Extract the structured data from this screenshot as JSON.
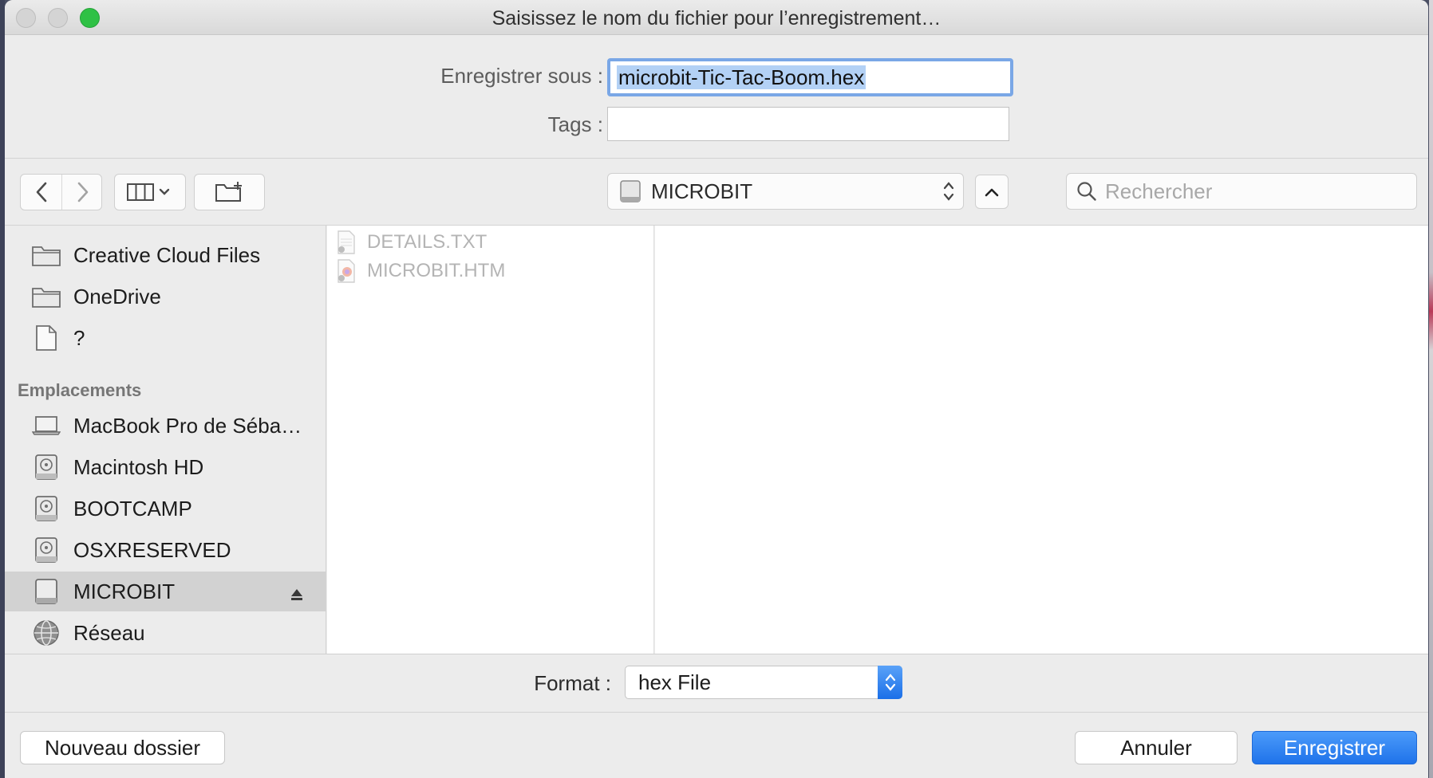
{
  "window": {
    "title": "Saisissez le nom du fichier pour l’enregistrement…"
  },
  "form": {
    "save_as_label": "Enregistrer sous :",
    "save_as_value": "microbit-Tic-Tac-Boom.hex",
    "tags_label": "Tags :",
    "tags_value": ""
  },
  "toolbar": {
    "location": "MICROBIT",
    "search_placeholder": "Rechercher"
  },
  "sidebar": {
    "favorites": [
      {
        "label": "Creative Cloud Files",
        "icon": "folder-icon"
      },
      {
        "label": "OneDrive",
        "icon": "folder-icon"
      },
      {
        "label": "?",
        "icon": "document-icon"
      }
    ],
    "locations_heading": "Emplacements",
    "locations": [
      {
        "label": "MacBook Pro de Séba…",
        "icon": "laptop-icon"
      },
      {
        "label": "Macintosh HD",
        "icon": "hard-drive-icon"
      },
      {
        "label": "BOOTCAMP",
        "icon": "hard-drive-icon"
      },
      {
        "label": "OSXRESERVED",
        "icon": "hard-drive-icon"
      },
      {
        "label": "MICROBIT",
        "icon": "external-drive-icon",
        "selected": true
      },
      {
        "label": "Réseau",
        "icon": "network-globe-icon"
      }
    ]
  },
  "files": [
    {
      "name": "DETAILS.TXT",
      "icon": "text-file-icon"
    },
    {
      "name": "MICROBIT.HTM",
      "icon": "html-file-icon"
    }
  ],
  "bottom": {
    "format_label": "Format :",
    "format_value": "hex File",
    "new_folder": "Nouveau dossier",
    "cancel": "Annuler",
    "save": "Enregistrer"
  },
  "colors": {
    "accent": "#1f73ea",
    "selection": "#b3d1f5",
    "focus_ring": "#7aa7e6",
    "zoom_button": "#2fc145"
  }
}
